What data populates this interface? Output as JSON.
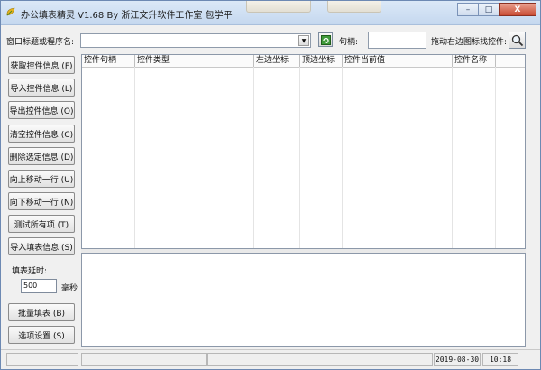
{
  "window": {
    "title": "办公填表精灵 V1.68 By 浙江文升软件工作室 包学平",
    "controls": {
      "minimize": "–",
      "maximize": "□",
      "close": "X"
    }
  },
  "toolbar": {
    "window_label": "窗口标题或程序名:",
    "handle_label": "句柄:",
    "drag_label": "拖动右边图标找控件:",
    "window_value": "",
    "handle_value": ""
  },
  "sidebar": {
    "buttons": [
      "获取控件信息 (F)",
      "导入控件信息 (L)",
      "导出控件信息 (O)",
      "清空控件信息 (C)",
      "删除选定信息 (D)",
      "向上移动一行 (U)",
      "向下移动一行 (N)",
      "测试所有项 (T)",
      "导入填表信息 (S)"
    ],
    "delay_label": "填表延时:",
    "delay_value": "500",
    "delay_unit": "毫秒",
    "batch_button": "批量填表 (B)",
    "options_button": "选项设置 (S)"
  },
  "grid": {
    "columns": [
      "控件句柄",
      "控件类型",
      "左边坐标",
      "顶边坐标",
      "控件当前值",
      "控件名称"
    ]
  },
  "statusbar": {
    "date": "2019-08-30",
    "time": "10:18"
  },
  "colors": {
    "title_bar": "#c5d8ef",
    "close_button": "#c84b33",
    "window_bg": "#f0f0f0"
  }
}
